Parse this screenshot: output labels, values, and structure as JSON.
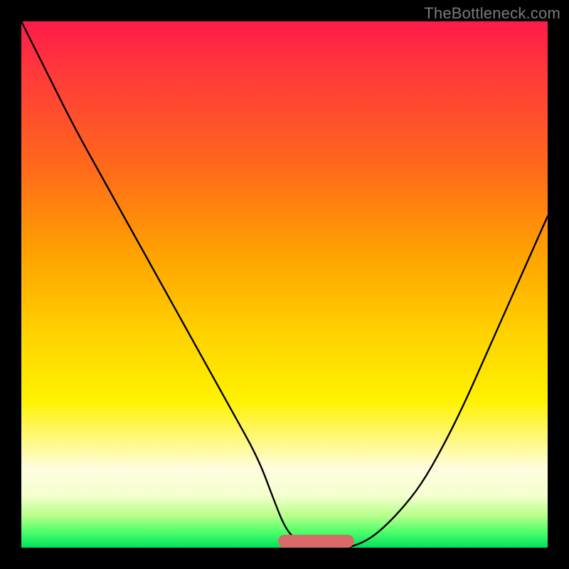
{
  "attribution": "TheBottleneck.com",
  "chart_data": {
    "type": "line",
    "title": "",
    "xlabel": "",
    "ylabel": "",
    "xlim": [
      0,
      100
    ],
    "ylim": [
      0,
      100
    ],
    "series": [
      {
        "name": "left-curve",
        "x": [
          0,
          5,
          10,
          15,
          20,
          25,
          30,
          35,
          40,
          45,
          48,
          50,
          52,
          55,
          58
        ],
        "values": [
          100,
          90,
          80,
          71,
          62,
          53,
          44,
          35,
          26,
          17,
          9,
          4,
          1.5,
          0.5,
          0
        ]
      },
      {
        "name": "right-curve",
        "x": [
          62,
          65,
          68,
          72,
          76,
          80,
          84,
          88,
          92,
          96,
          100
        ],
        "values": [
          0,
          1,
          3,
          7,
          12,
          19,
          27,
          36,
          45,
          54,
          63
        ]
      }
    ],
    "annotations": [
      {
        "name": "flat-bottom-band",
        "type": "segment",
        "x": [
          50,
          62
        ],
        "y": [
          0,
          0
        ],
        "color": "#d96a6a"
      }
    ]
  },
  "colors": {
    "curve": "#000000",
    "band": "#d96a6a"
  }
}
